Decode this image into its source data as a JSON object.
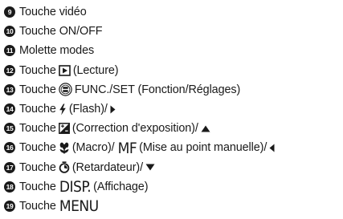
{
  "items": [
    {
      "num": "9",
      "pre": "Touche vidéo"
    },
    {
      "num": "10",
      "pre": "Touche ON/OFF"
    },
    {
      "num": "11",
      "pre": "Molette modes"
    },
    {
      "num": "12",
      "pre": "Touche",
      "post": "(Lecture)",
      "icon": "play-icon"
    },
    {
      "num": "13",
      "pre": "Touche",
      "post": "FUNC./SET (Fonction/Réglages)",
      "icon": "func-set-icon"
    },
    {
      "num": "14",
      "pre": "Touche",
      "post": "(Flash)/",
      "icon": "flash-icon",
      "post_icon": "arrow-right-icon"
    },
    {
      "num": "15",
      "pre": "Touche",
      "post": "(Correction d'exposition)/",
      "icon": "exposure-compensation-icon",
      "post_icon": "arrow-up-icon"
    },
    {
      "num": "16",
      "pre": "Touche",
      "mid": "(Macro)/",
      "big": "MF",
      "post": "(Mise au point manuelle)/",
      "icon": "macro-icon",
      "post_icon": "arrow-left-icon"
    },
    {
      "num": "17",
      "pre": "Touche",
      "post": "(Retardateur)/",
      "icon": "self-timer-icon",
      "post_icon": "arrow-down-icon"
    },
    {
      "num": "18",
      "pre": "Touche",
      "big": "DISP.",
      "post": "(Affichage)"
    },
    {
      "num": "19",
      "pre": "Touche",
      "big": "MENU"
    }
  ]
}
